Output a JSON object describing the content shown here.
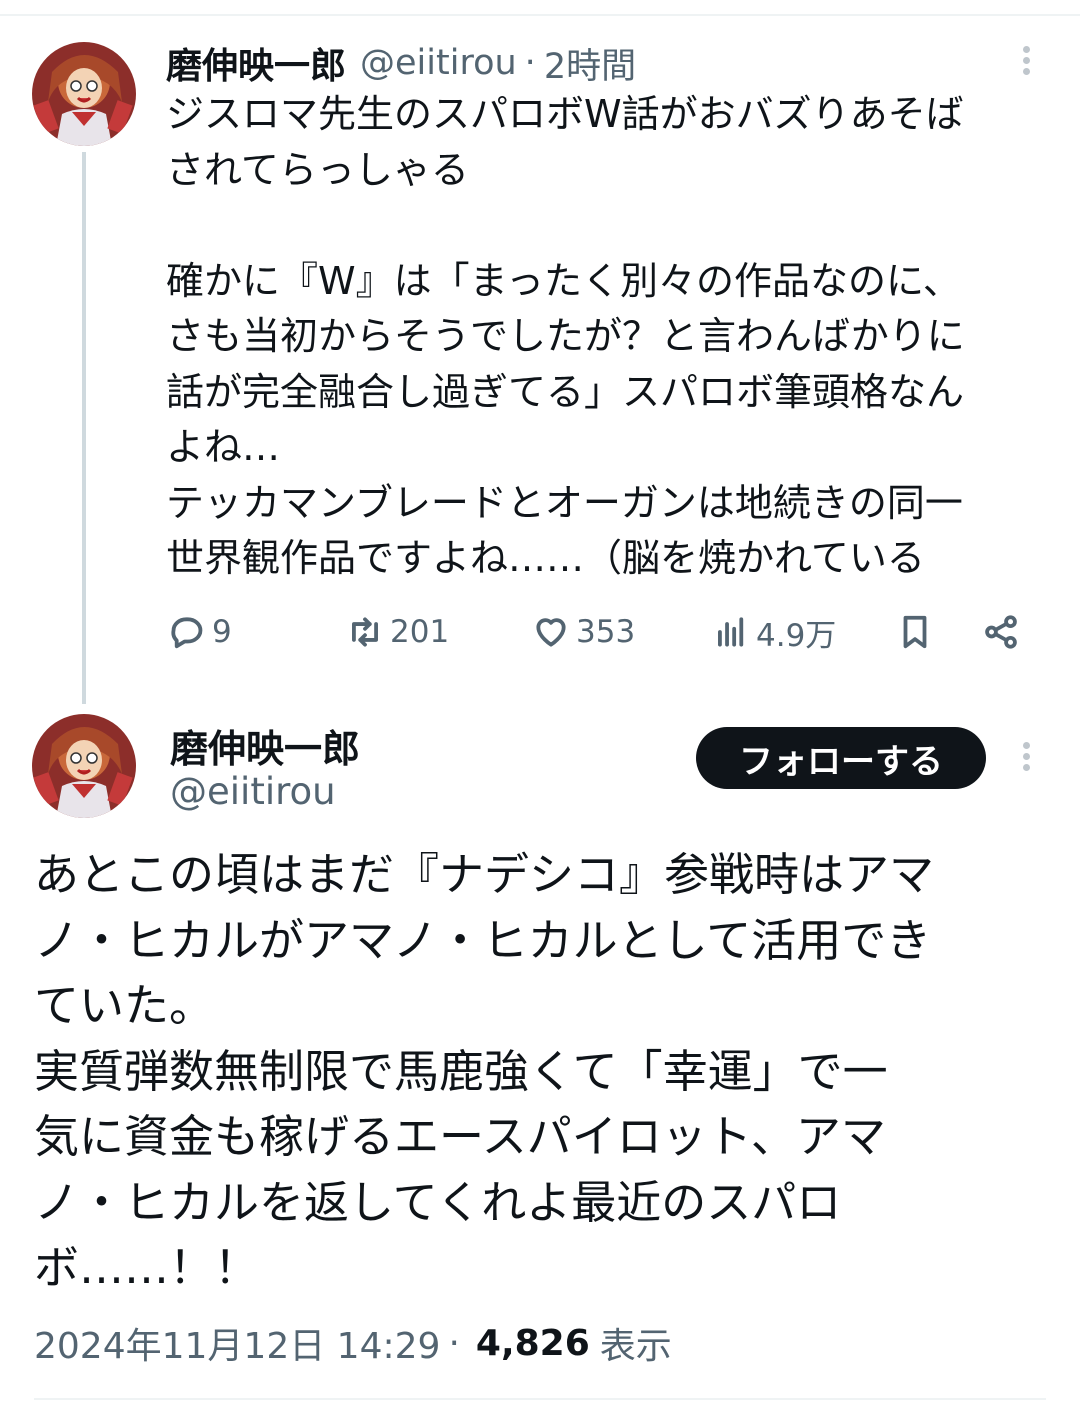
{
  "tweet1": {
    "display_name": "磨伸映一郎",
    "handle": "@eiitirou",
    "separator": "·",
    "time": "2時間",
    "lines": [
      "ジスロマ先生のスパロボW話がおバズりあそば",
      "されてらっしゃる",
      "",
      "確かに『W』は「まったく別々の作品なのに、",
      "さも当初からそうでしたが？と言わんばかりに",
      "話が完全融合し過ぎてる」スパロボ筆頭格なん",
      "よね…",
      "テッカマンブレードとオーガンは地続きの同一",
      "世界観作品ですよね……（脳を焼かれている"
    ],
    "actions": {
      "replies": "9",
      "retweets": "201",
      "likes": "353",
      "views": "4.9万"
    }
  },
  "tweet2": {
    "display_name": "磨伸映一郎",
    "handle": "@eiitirou",
    "follow_label": "フォローする",
    "lines": [
      "あとこの頃はまだ『ナデシコ』参戦時はアマ",
      "ノ・ヒカルがアマノ・ヒカルとして活用でき",
      "ていた。",
      "実質弾数無制限で馬鹿強くて「幸運」で一",
      "気に資金も稼げるエースパイロット、アマ",
      "ノ・ヒカルを返してくれよ最近のスパロ",
      "ボ……！！"
    ],
    "timestamp": "2024年11月12日 14:29",
    "separator": "·",
    "view_count": "4,826",
    "view_label": "表示"
  },
  "icons": [
    "more-icon",
    "reply-icon",
    "retweet-icon",
    "like-icon",
    "views-icon",
    "bookmark-icon",
    "share-icon",
    "avatar"
  ]
}
